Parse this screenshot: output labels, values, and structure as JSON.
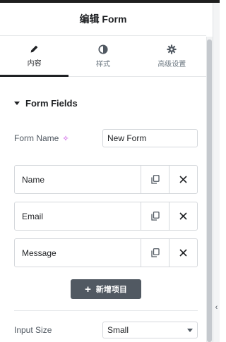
{
  "header": {
    "title": "编辑 Form"
  },
  "tabs": [
    {
      "label": "内容",
      "icon": "pencil-icon",
      "active": true
    },
    {
      "label": "样式",
      "icon": "half-circle-icon",
      "active": false
    },
    {
      "label": "高级设置",
      "icon": "gear-icon",
      "active": false
    }
  ],
  "section": {
    "title": "Form Fields"
  },
  "form_name": {
    "label": "Form Name",
    "value": "New Form"
  },
  "fields": [
    {
      "title": "Name"
    },
    {
      "title": "Email"
    },
    {
      "title": "Message"
    }
  ],
  "add_item": {
    "label": "新增项目"
  },
  "input_size": {
    "label": "Input Size",
    "value": "Small"
  },
  "colors": {
    "accent": "#515962",
    "text": "#1f2124",
    "border": "#d5d8dc"
  }
}
